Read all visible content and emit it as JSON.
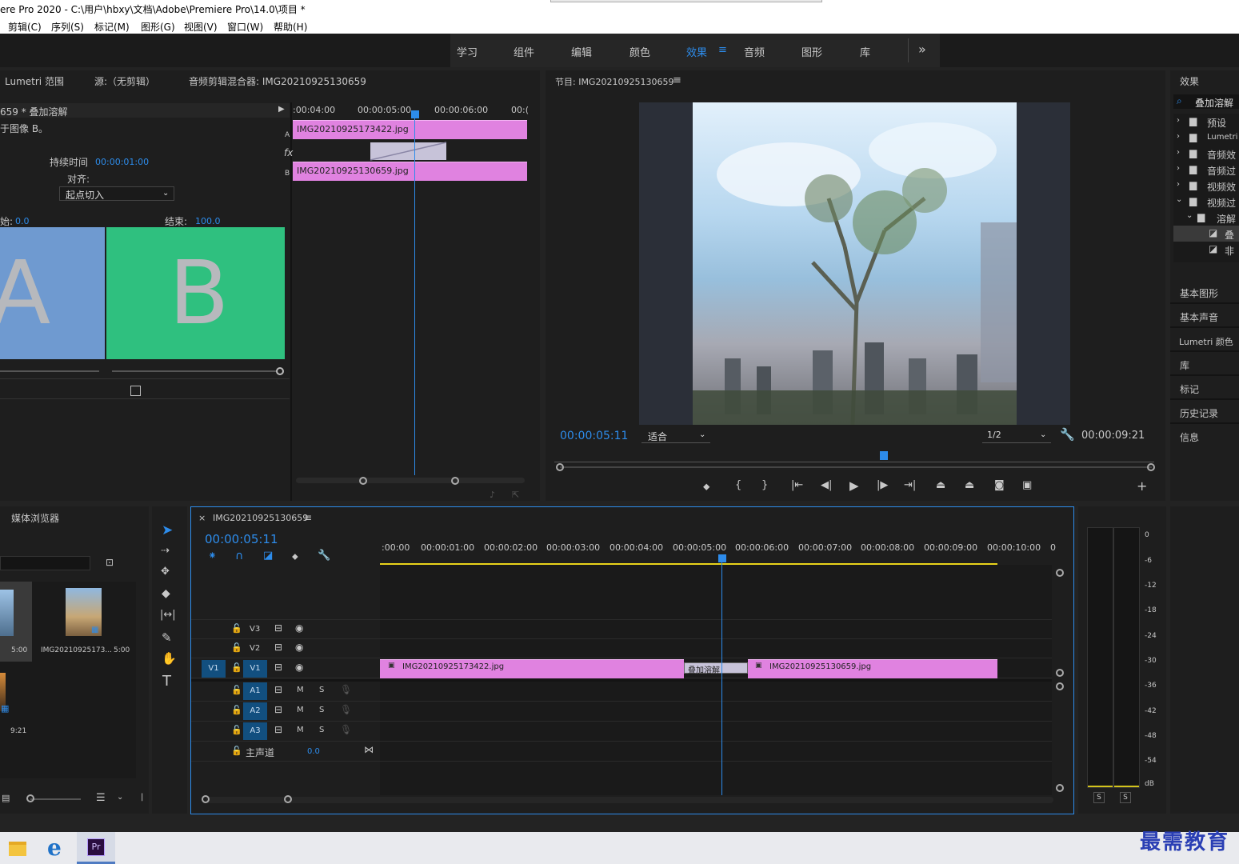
{
  "title_bar": {
    "title": "ere Pro 2020 - C:\\用户\\hbxy\\文档\\Adobe\\Premiere Pro\\14.0\\项目 *"
  },
  "menu": [
    "剪辑(C)",
    "序列(S)",
    "标记(M)",
    "图形(G)",
    "视图(V)",
    "窗口(W)",
    "帮助(H)"
  ],
  "workspaces": {
    "items": [
      "学习",
      "组件",
      "编辑",
      "颜色",
      "效果",
      "音频",
      "图形",
      "库"
    ],
    "active": "效果",
    "more": "»"
  },
  "source_panel": {
    "tabs": [
      "Lumetri 范围",
      "源:（无剪辑）",
      "音频剪辑混合器: IMG20210925130659"
    ],
    "clip_header": "659 * 叠加溶解",
    "desc": "于图像 B。",
    "duration_label": "持续时间",
    "duration_value": "00:00:01:00",
    "align_label": "对齐:",
    "align_value": "起点切入",
    "start_label": "始:",
    "start_value": "0.0",
    "end_label": "结束:",
    "end_value": "100.0",
    "preview_a": "A",
    "preview_b": "B",
    "track_a": "A",
    "track_b": "B",
    "fx": "fx",
    "mini_times": [
      ":00:04:00",
      "00:00:05:00",
      "00:00:06:00",
      "00:("
    ],
    "clip_a": "IMG20210925173422.jpg",
    "clip_b": "IMG20210925130659.jpg"
  },
  "program": {
    "title": "节目: IMG20210925130659",
    "timecode": "00:00:05:11",
    "fit": "适合",
    "quality": "1/2",
    "duration": "00:00:09:21",
    "colors": {
      "tc": "#2d8ceb"
    }
  },
  "effects_panel": {
    "title": "效果",
    "search": "叠加溶解",
    "tree": [
      {
        "label": "预设",
        "level": 0,
        "expanded": false
      },
      {
        "label": "Lumetri",
        "level": 0,
        "expanded": false
      },
      {
        "label": "音频效",
        "level": 0,
        "expanded": false
      },
      {
        "label": "音频过",
        "level": 0,
        "expanded": false
      },
      {
        "label": "视频效",
        "level": 0,
        "expanded": false
      },
      {
        "label": "视频过",
        "level": 0,
        "expanded": true
      },
      {
        "label": "溶解",
        "level": 1,
        "expanded": true
      },
      {
        "label": "叠",
        "level": 2,
        "selected": true
      },
      {
        "label": "非",
        "level": 2
      }
    ],
    "panels": [
      "基本图形",
      "基本声音",
      "Lumetri 颜色",
      "库",
      "标记",
      "历史记录",
      "信息"
    ]
  },
  "project": {
    "title": "媒体浏览器",
    "items": [
      {
        "duration": "5:00"
      },
      {
        "name": "IMG20210925173...",
        "duration": "5:00"
      },
      {
        "duration": "9:21"
      }
    ]
  },
  "timeline": {
    "close": "×",
    "title": "IMG20210925130659",
    "menu": "≡",
    "timecode": "00:00:05:11",
    "ruler": [
      ":00:00",
      "00:00:01:00",
      "00:00:02:00",
      "00:00:03:00",
      "00:00:04:00",
      "00:00:05:00",
      "00:00:06:00",
      "00:00:07:00",
      "00:00:08:00",
      "00:00:09:00",
      "00:00:10:00",
      "0"
    ],
    "video_tracks": [
      "V3",
      "V2",
      "V1"
    ],
    "source_patch": "V1",
    "audio_tracks": [
      "A1",
      "A2",
      "A3"
    ],
    "master": {
      "label": "主声道",
      "value": "0.0"
    },
    "mute": "M",
    "solo": "S",
    "clip1": "IMG20210925173422.jpg",
    "clip2": "IMG20210925130659.jpg",
    "transition": "叠加溶解"
  },
  "meter": {
    "scale": [
      "0",
      "-6",
      "-12",
      "-18",
      "-24",
      "-30",
      "-36",
      "-42",
      "-48",
      "-54",
      "dB"
    ],
    "solo": [
      "S",
      "S"
    ]
  },
  "watermark": "最需教育",
  "colors": {
    "clip": "#e082e0",
    "accent": "#2d8ceb",
    "transition": "#c7c3d9"
  }
}
